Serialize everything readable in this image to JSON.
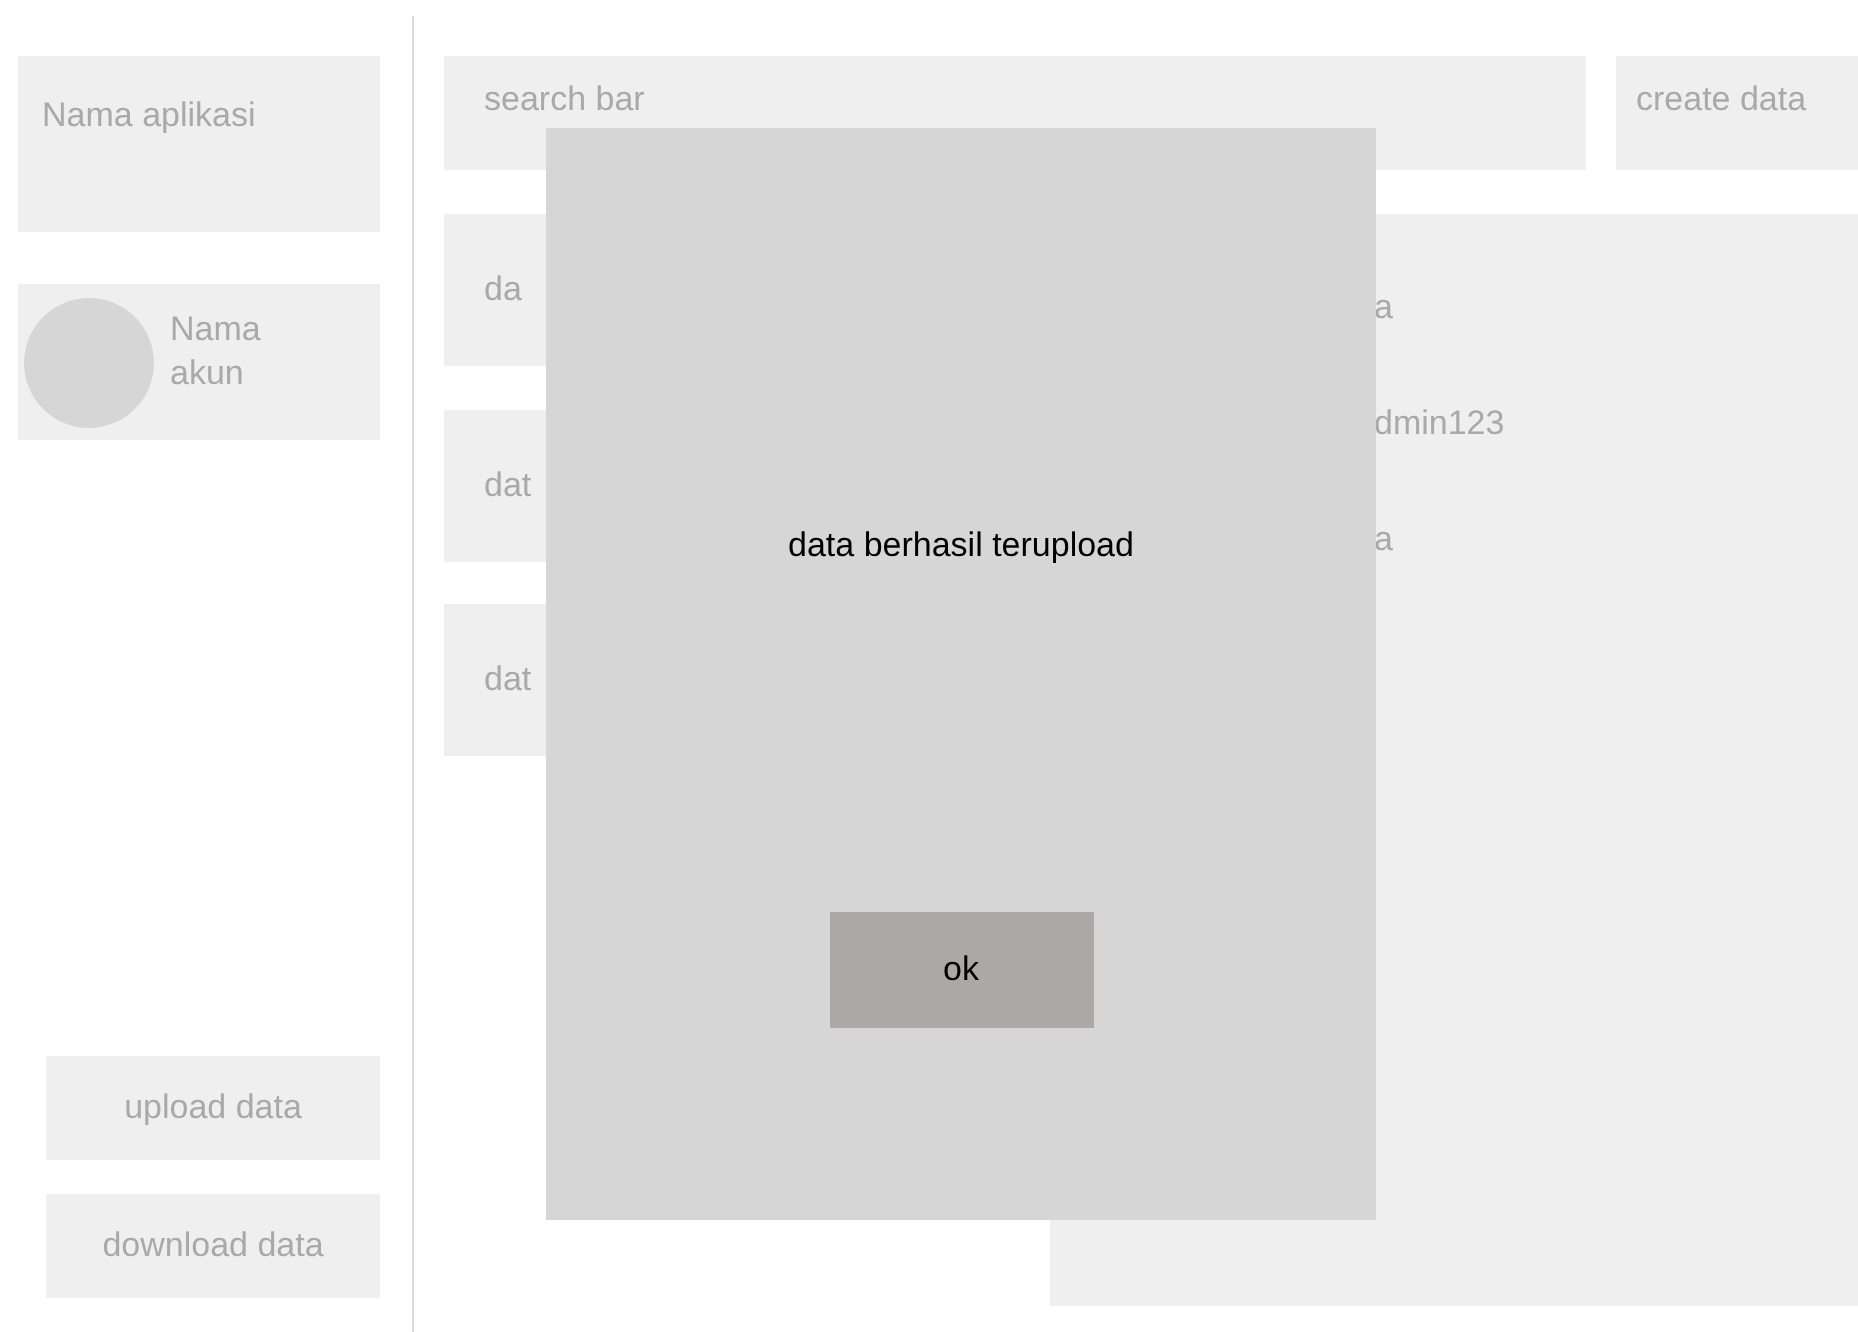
{
  "sidebar": {
    "app_name": "Nama aplikasi",
    "account": {
      "name": "Nama akun"
    },
    "buttons": [
      {
        "label": "upload data"
      },
      {
        "label": "download data"
      }
    ]
  },
  "search": {
    "placeholder": "search bar"
  },
  "create_button": {
    "label": "create data"
  },
  "data_list": [
    {
      "label": "da"
    },
    {
      "label": "dat"
    },
    {
      "label": "dat"
    }
  ],
  "detail": {
    "lines": [
      "a",
      "dmin123",
      "a"
    ]
  },
  "dialog": {
    "message": "data berhasil terupload",
    "button": "ok"
  }
}
